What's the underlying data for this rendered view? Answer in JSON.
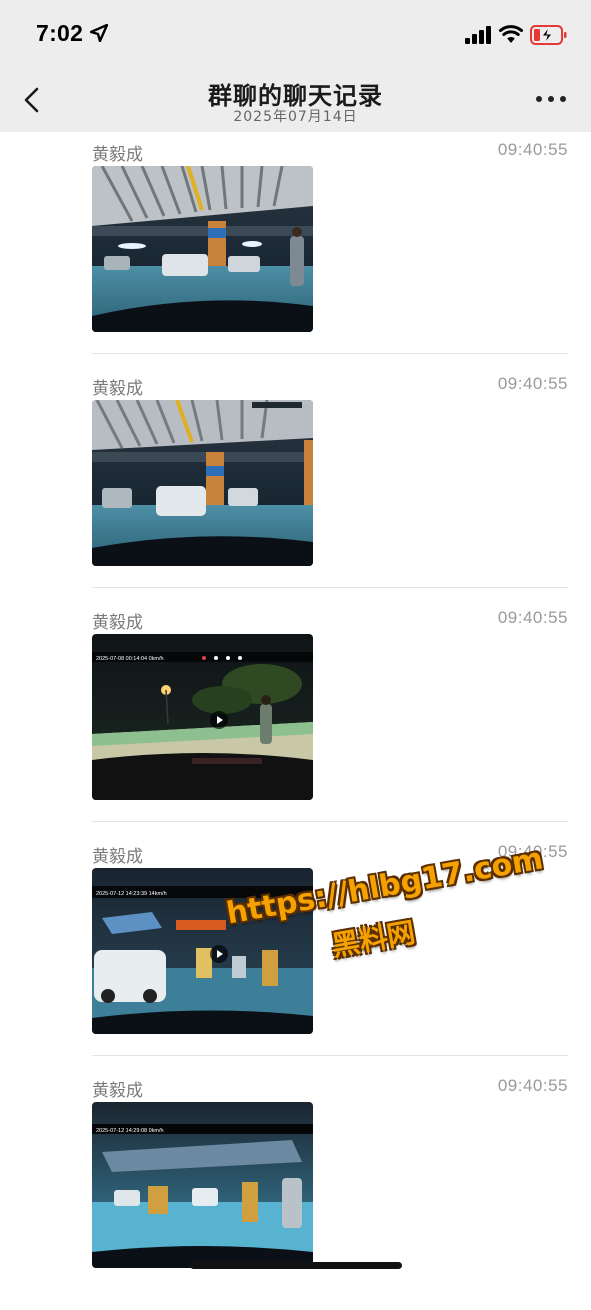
{
  "status_bar": {
    "time": "7:02",
    "icons": [
      "location-arrow-icon",
      "cellular-signal-icon",
      "wifi-icon",
      "low-battery-charging-icon"
    ],
    "battery_color": "#e53935"
  },
  "nav": {
    "title": "群聊的聊天记录",
    "subtitle": "2025年07月14日",
    "back_icon": "chevron-left-icon",
    "more_icon": "ellipsis-icon"
  },
  "messages": [
    {
      "sender": "黄毅成",
      "time": "09:40:55",
      "type": "image"
    },
    {
      "sender": "黄毅成",
      "time": "09:40:55",
      "type": "image"
    },
    {
      "sender": "黄毅成",
      "time": "09:40:55",
      "type": "video",
      "overlay_text": "2025-07-08 00:14:04   0km/h"
    },
    {
      "sender": "黄毅成",
      "time": "09:40:55",
      "type": "video",
      "overlay_text": "2025-07-12 14:23:39   14km/h"
    },
    {
      "sender": "黄毅成",
      "time": "09:40:55",
      "type": "image",
      "overlay_text": "2025-07-12 14:29:08   0km/h"
    }
  ],
  "watermark": {
    "url": "https://hlbg17.com",
    "name": "黑料网",
    "color": "#f5a200"
  }
}
